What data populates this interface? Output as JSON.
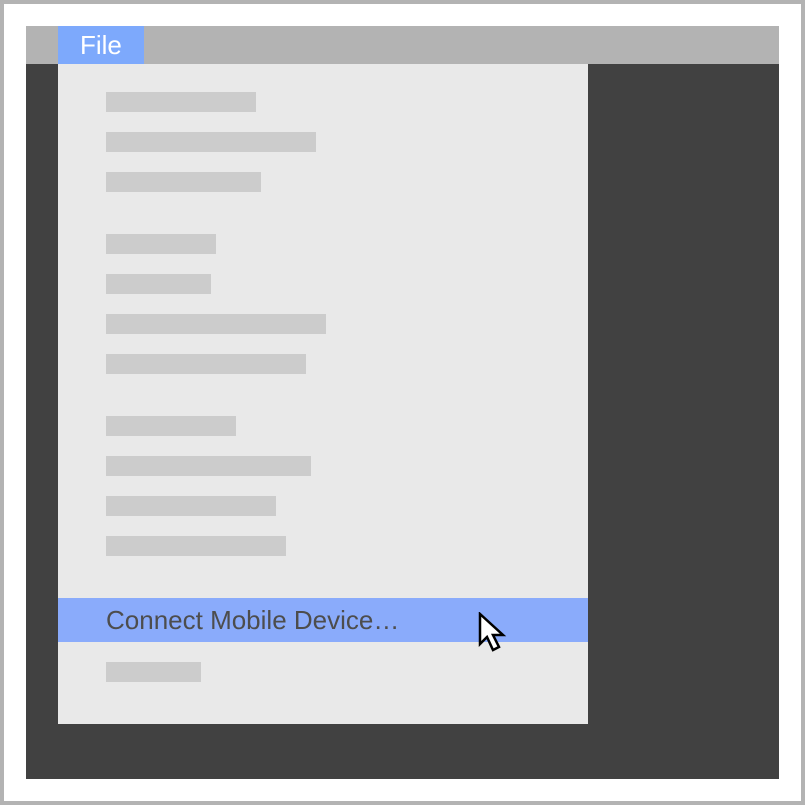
{
  "menubar": {
    "file_label": "File"
  },
  "dropdown": {
    "groups": [
      {
        "placeholders": [
          150,
          210,
          155
        ]
      },
      {
        "placeholders": [
          110,
          105,
          220,
          200
        ]
      },
      {
        "placeholders": [
          130,
          205,
          170,
          180
        ]
      }
    ],
    "active_item_label": "Connect Mobile Device…",
    "trailing_placeholders": [
      95
    ]
  },
  "colors": {
    "highlight": "#8aabfb",
    "menubar_item": "#7da9fc",
    "app_bg": "#414141",
    "dropdown_bg": "#e9e9e9",
    "placeholder": "#cccccc"
  }
}
